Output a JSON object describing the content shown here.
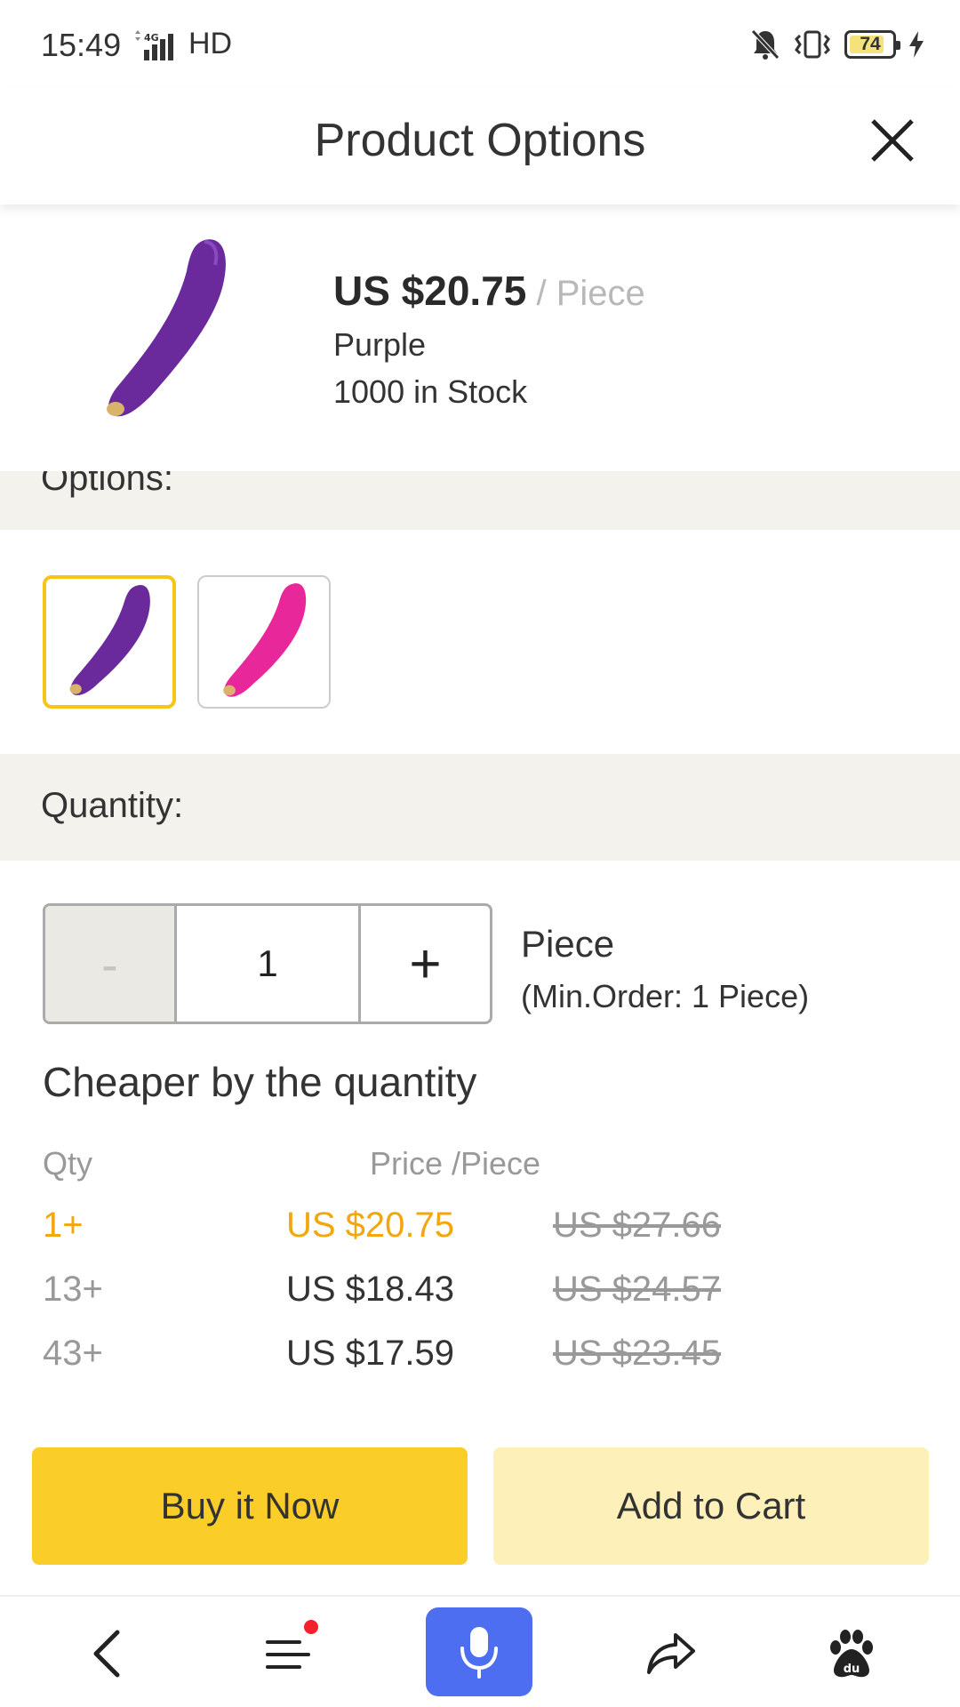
{
  "status_bar": {
    "time": "15:49",
    "network": "4G",
    "hd": "HD",
    "battery": "74"
  },
  "header": {
    "title": "Product Options",
    "close_icon": "close-icon"
  },
  "product": {
    "price": "US $20.75",
    "price_unit": " / Piece",
    "color": "Purple",
    "stock": "1000 in Stock"
  },
  "options": {
    "label": "Options:",
    "variants": [
      {
        "color": "#6a2a9c",
        "selected": true
      },
      {
        "color": "#e8289a",
        "selected": false
      }
    ]
  },
  "quantity": {
    "label": "Quantity:",
    "minus": "-",
    "value": "1",
    "plus": "+",
    "unit": "Piece",
    "min_order": "(Min.Order: 1 Piece)"
  },
  "tiers": {
    "title": "Cheaper by the quantity",
    "col_qty": "Qty",
    "col_price": "Price /Piece",
    "rows": [
      {
        "qty": "1+",
        "price": "US $20.75",
        "old": "US $27.66"
      },
      {
        "qty": "13+",
        "price": "US $18.43",
        "old": "US $24.57"
      },
      {
        "qty": "43+",
        "price": "US $17.59",
        "old": "US $23.45"
      }
    ]
  },
  "actions": {
    "buy_now": "Buy it Now",
    "add_to_cart": "Add to Cart"
  },
  "colors": {
    "accent": "#fbcd28",
    "accent_light": "#fdf0b8",
    "price_highlight": "#f3a60d",
    "mic_button": "#4e6ef2"
  }
}
